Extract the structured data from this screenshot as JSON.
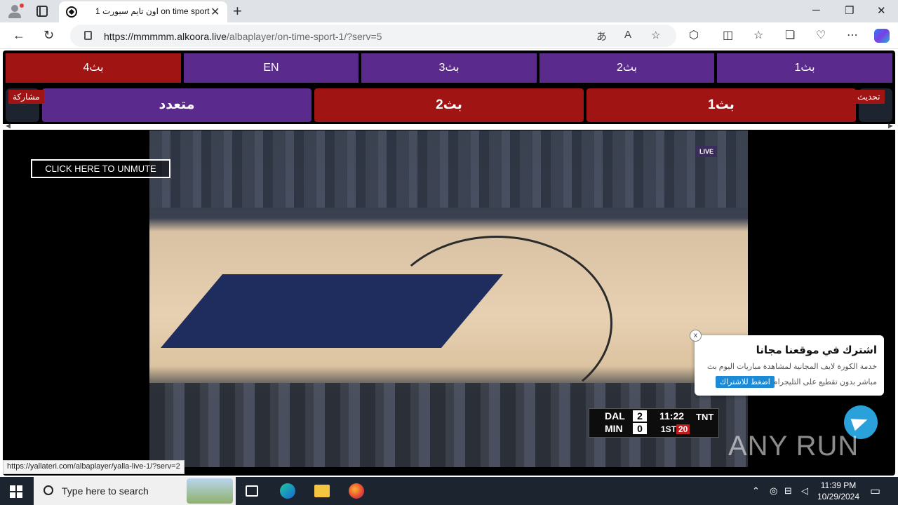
{
  "browser": {
    "tab_title": "اون تايم سبورت 1 on time sport",
    "url_domain": "https://mmmmm.alkoora.live",
    "url_path": "/albaplayer/on-time-sport-1/?serv=5",
    "status_url": "https://yallateri.com/albaplayer/yalla-live-1/?serv=2"
  },
  "servers_row1": [
    "بث4",
    "EN",
    "بث3",
    "بث2",
    "بث1"
  ],
  "servers_row2": [
    "متعدد",
    "بث2",
    "بث1"
  ],
  "tags": {
    "share": "مشاركة",
    "refresh": "تحديث"
  },
  "video": {
    "unmute_label": "CLICK HERE TO UNMUTE",
    "live_badge": "LIVE",
    "scoreboard": {
      "team1": "DAL",
      "score1": "2",
      "team2": "MIN",
      "score2": "0",
      "clock": "11:22",
      "period": "1ST",
      "fouls": "20",
      "network": "TNT"
    }
  },
  "popup": {
    "title": "اشترك في موقعنا مجانا",
    "line1": "خدمة الكورة لايف المجانية لمشاهدة مباريات اليوم بث",
    "line2": "مباشر بدون تقطيع على التليجرام",
    "button": "اضغط للاشتراك",
    "close": "x"
  },
  "watermark": "ANY RUN",
  "taskbar": {
    "search_placeholder": "Type here to search",
    "time": "11:39 PM",
    "date": "10/29/2024"
  }
}
